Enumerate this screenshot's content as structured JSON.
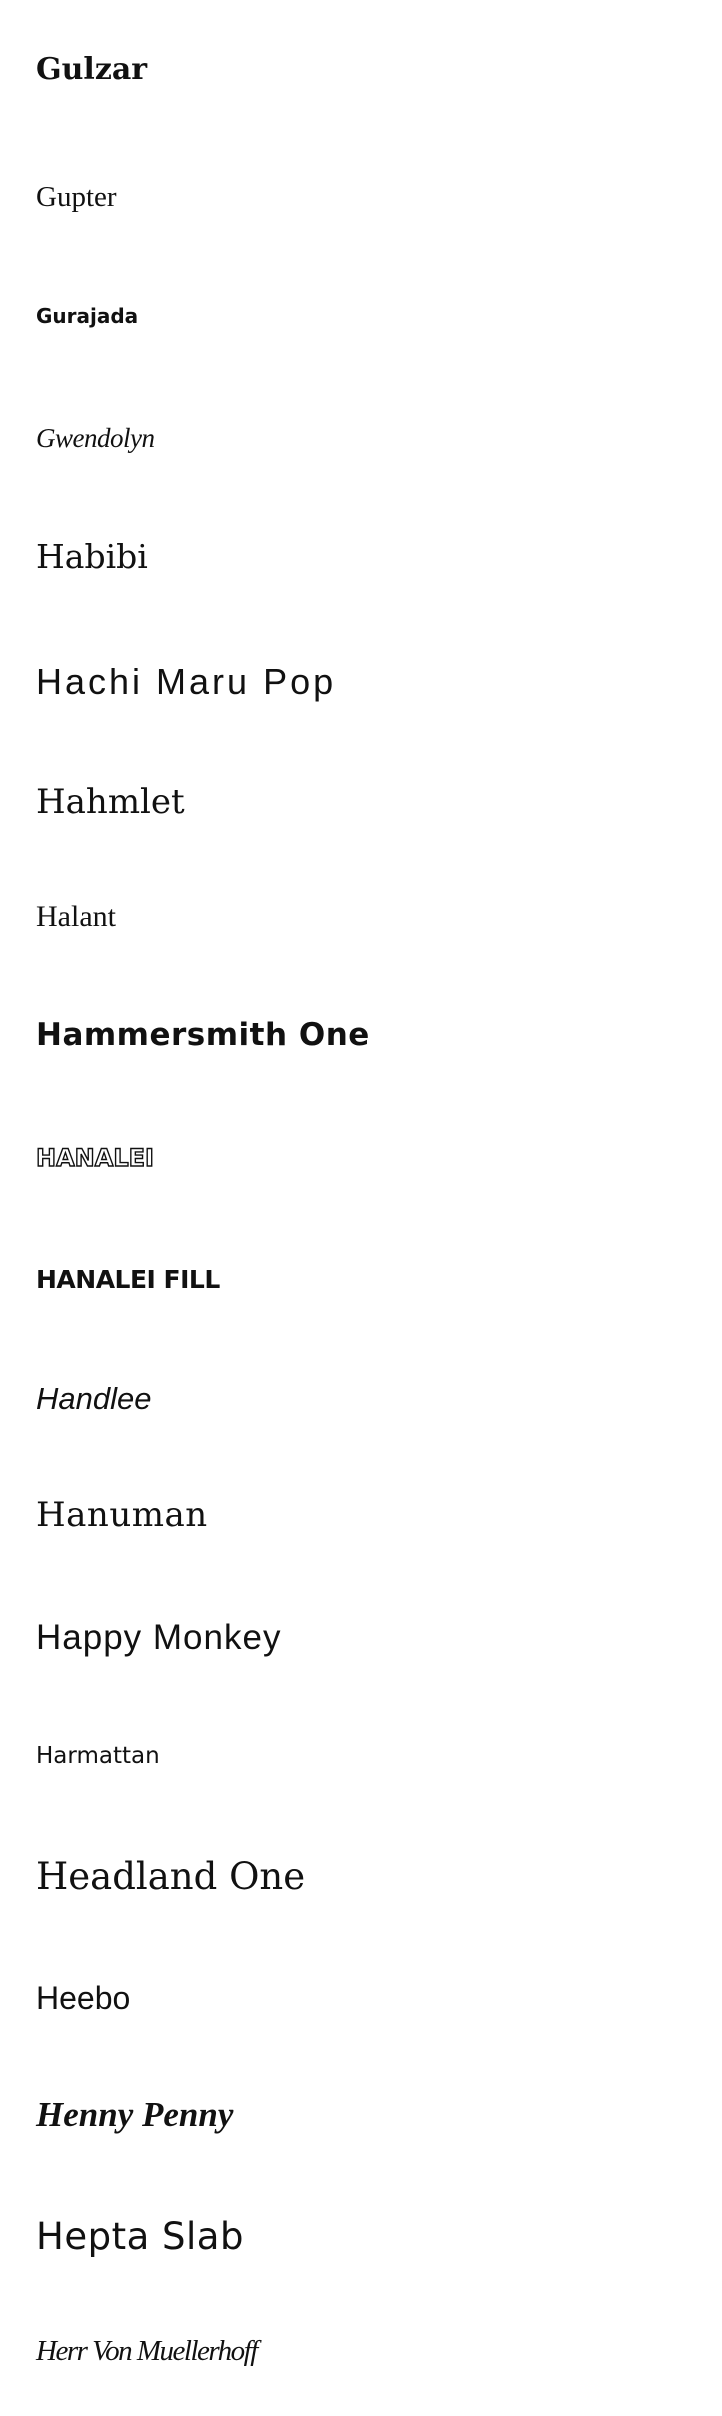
{
  "fonts": [
    {
      "name": "Gulzar"
    },
    {
      "name": "Gupter"
    },
    {
      "name": "Gurajada"
    },
    {
      "name": "Gwendolyn"
    },
    {
      "name": "Habibi"
    },
    {
      "name": "Hachi Maru Pop"
    },
    {
      "name": "Hahmlet"
    },
    {
      "name": "Halant"
    },
    {
      "name": "Hammersmith One"
    },
    {
      "name": "HANALEI"
    },
    {
      "name": "HANALEI FILL"
    },
    {
      "name": "Handlee"
    },
    {
      "name": "Hanuman"
    },
    {
      "name": "Happy Monkey"
    },
    {
      "name": "Harmattan"
    },
    {
      "name": "Headland One"
    },
    {
      "name": "Heebo"
    },
    {
      "name": "Henny Penny"
    },
    {
      "name": "Hepta Slab"
    },
    {
      "name": "Herr Von Muellerhoff"
    }
  ]
}
